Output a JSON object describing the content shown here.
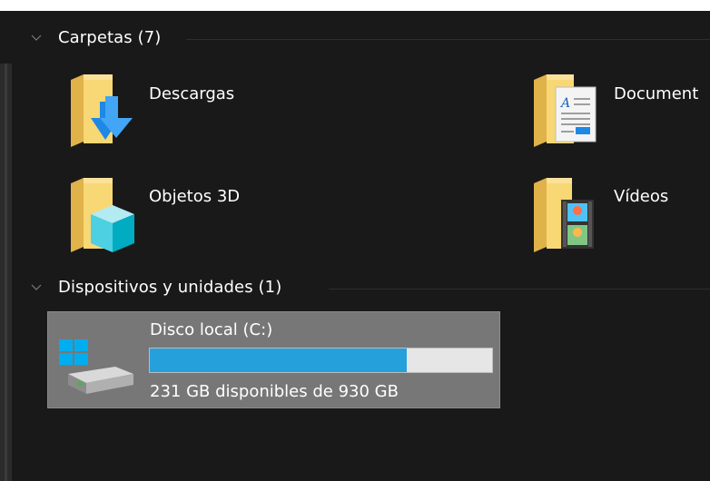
{
  "sections": {
    "folders": {
      "label": "Carpetas (7)",
      "items": [
        {
          "label": "Descargas",
          "icon": "downloads-folder-icon"
        },
        {
          "label": "Document",
          "icon": "documents-folder-icon"
        },
        {
          "label": "Objetos 3D",
          "icon": "3d-objects-folder-icon"
        },
        {
          "label": "Vídeos",
          "icon": "videos-folder-icon"
        }
      ]
    },
    "devices": {
      "label": "Dispositivos y unidades (1)",
      "drives": [
        {
          "title": "Disco local (C:)",
          "free_text": "231 GB disponibles de 930 GB",
          "used_fraction": 0.75,
          "icon": "local-disk-icon"
        }
      ]
    }
  },
  "colors": {
    "background": "#191919",
    "selection": "#777777",
    "progress_fill": "#26a0da",
    "progress_track": "#e6e6e6",
    "folder": "#f8d775"
  }
}
